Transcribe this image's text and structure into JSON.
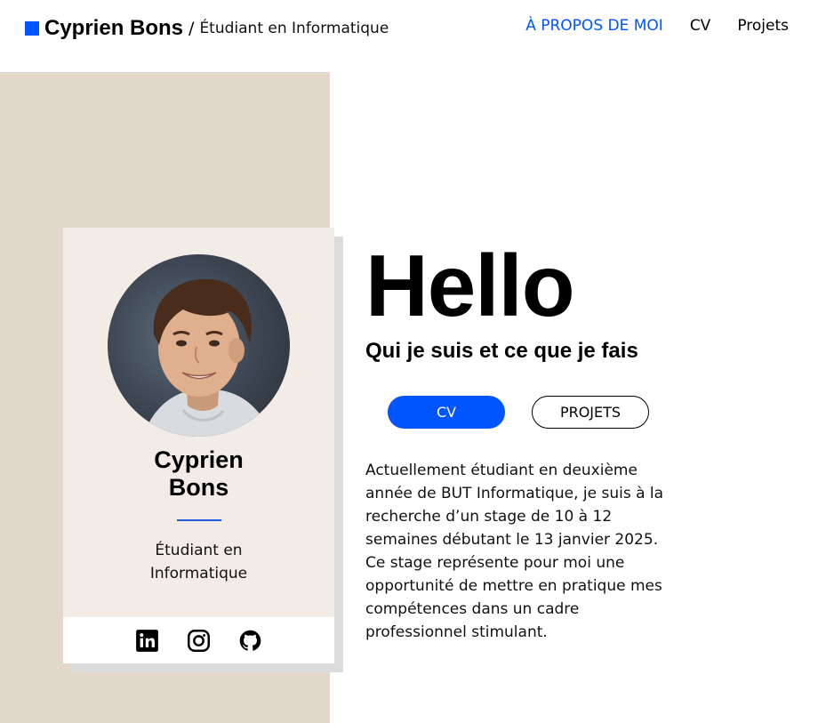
{
  "header": {
    "brand_name": "Cyprien Bons",
    "separator": "/",
    "brand_subtitle": "Étudiant en Informatique",
    "nav": [
      {
        "label": "À PROPOS DE MOI",
        "active": true
      },
      {
        "label": "CV",
        "active": false
      },
      {
        "label": "Projets",
        "active": false
      }
    ]
  },
  "card": {
    "name": "Cyprien Bons",
    "role": "Étudiant en Informatique",
    "social": [
      "linkedin-icon",
      "instagram-icon",
      "github-icon"
    ]
  },
  "main": {
    "hello": "Hello",
    "subtitle": "Qui je suis et ce que je fais",
    "cv_button": "CV",
    "projets_button": "PROJETS",
    "about": "Actuellement étudiant en deuxième année de BUT Informatique, je suis à la recherche d’un stage de 10 à 12 semaines débutant le 13 janvier 2025. Ce stage représente pour moi une opportunité de mettre en pratique mes compétences dans un cadre professionnel stimulant."
  },
  "colors": {
    "accent": "#0055ff",
    "beige_panel": "#e2d8cc",
    "card_bg": "#f3ece6"
  }
}
